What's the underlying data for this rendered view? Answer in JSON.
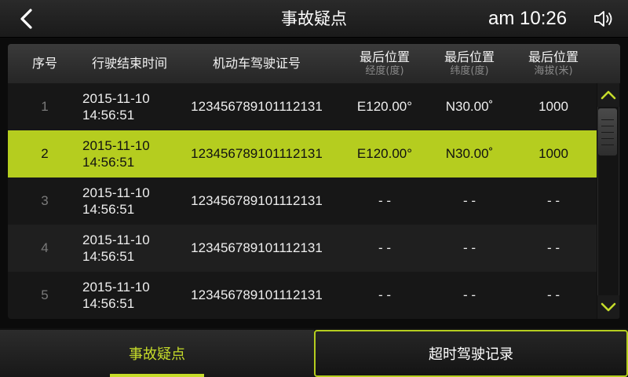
{
  "header": {
    "title": "事故疑点",
    "time": "am 10:26"
  },
  "table": {
    "columns": [
      {
        "label": "序号",
        "sub": ""
      },
      {
        "label": "行驶结束时间",
        "sub": ""
      },
      {
        "label": "机动车驾驶证号",
        "sub": ""
      },
      {
        "label": "最后位置",
        "sub": "经度(度)"
      },
      {
        "label": "最后位置",
        "sub": "纬度(度)"
      },
      {
        "label": "最后位置",
        "sub": "海拔(米)"
      }
    ],
    "rows": [
      {
        "seq": "1",
        "date": "2015-11-10",
        "time": "14:56:51",
        "license": "123456789101112131",
        "lon": "E120.00°",
        "lat": "N30.00˚",
        "alt": "1000"
      },
      {
        "seq": "2",
        "date": "2015-11-10",
        "time": "14:56:51",
        "license": "123456789101112131",
        "lon": "E120.00°",
        "lat": "N30.00˚",
        "alt": "1000"
      },
      {
        "seq": "3",
        "date": "2015-11-10",
        "time": "14:56:51",
        "license": "123456789101112131",
        "lon": "- -",
        "lat": "- -",
        "alt": "- -"
      },
      {
        "seq": "4",
        "date": "2015-11-10",
        "time": "14:56:51",
        "license": "123456789101112131",
        "lon": "- -",
        "lat": "- -",
        "alt": "- -"
      },
      {
        "seq": "5",
        "date": "2015-11-10",
        "time": "14:56:51",
        "license": "123456789101112131",
        "lon": "- -",
        "lat": "- -",
        "alt": "- -"
      }
    ],
    "selected_row": 2
  },
  "tabs": [
    {
      "label": "事故疑点",
      "active": true
    },
    {
      "label": "超时驾驶记录",
      "active": false
    }
  ],
  "colors": {
    "accent": "#b5cd1f",
    "accent_text": "#c6dc2a",
    "background": "#0b0b0b"
  },
  "icons": {
    "back": "chevron-left-icon",
    "volume": "speaker-icon",
    "scroll_up": "chevron-up-icon",
    "scroll_down": "chevron-down-icon"
  }
}
